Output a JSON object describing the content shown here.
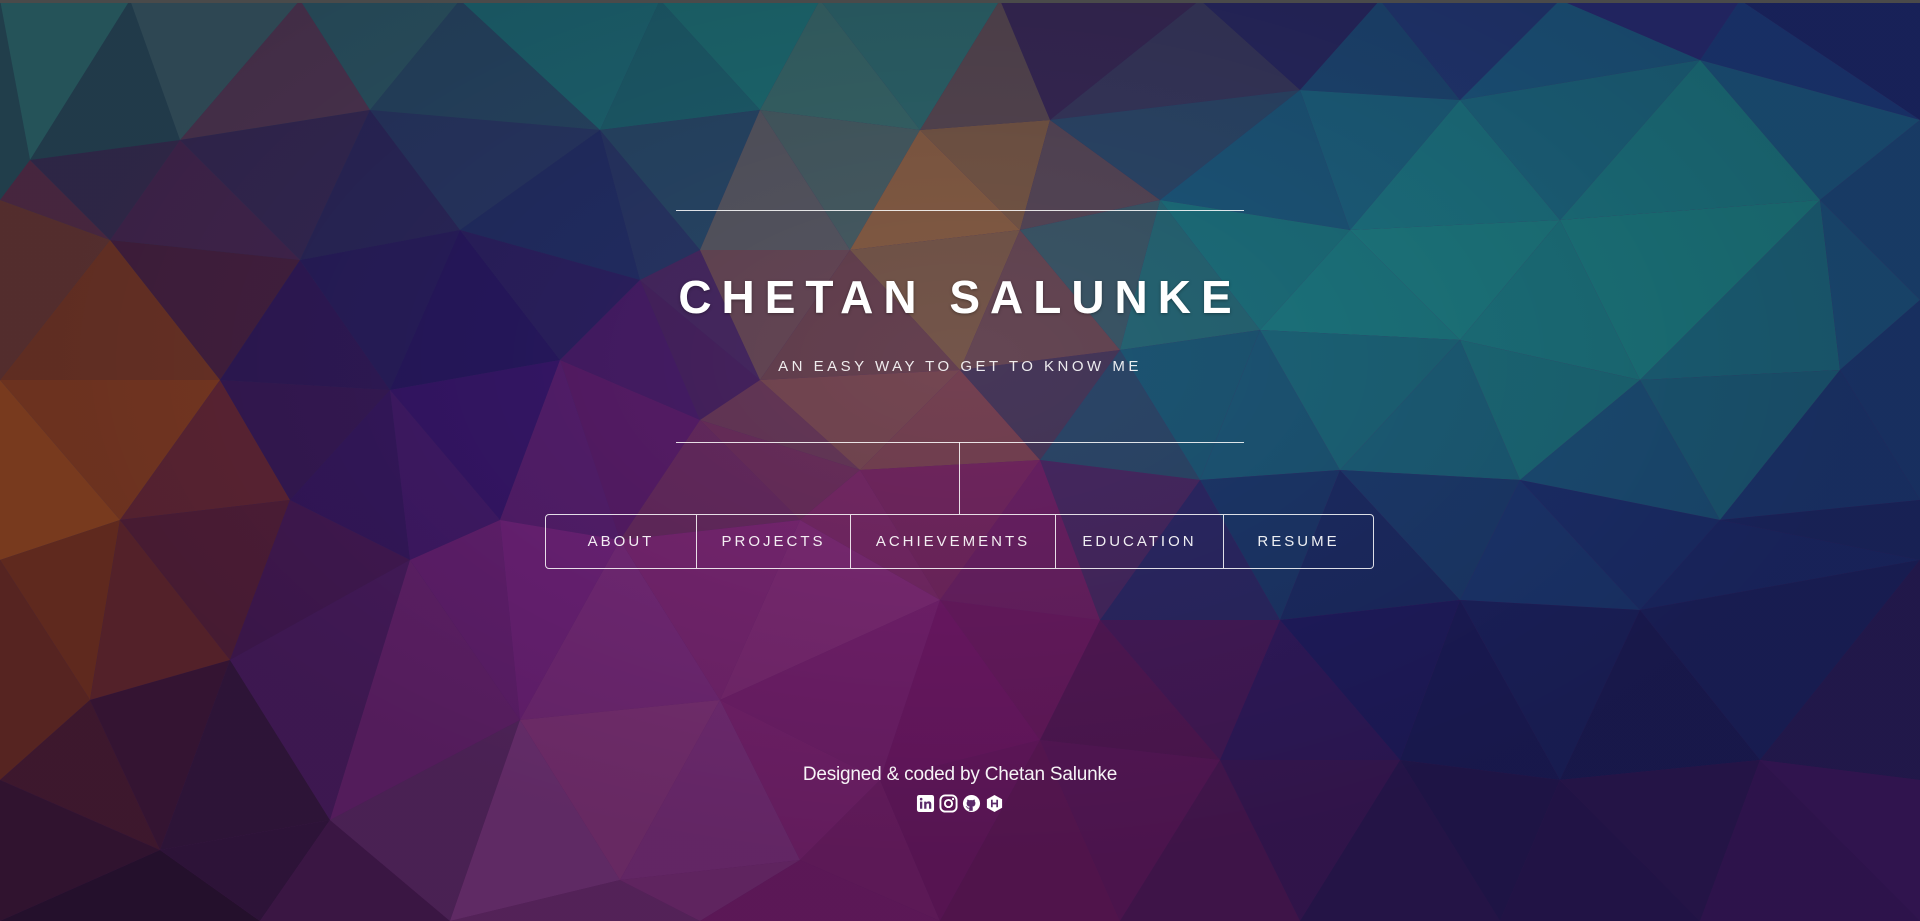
{
  "hero": {
    "title": "CHETAN SALUNKE",
    "subtitle": "AN EASY WAY TO GET TO KNOW ME"
  },
  "nav": {
    "items": [
      {
        "label": "ABOUT"
      },
      {
        "label": "PROJECTS"
      },
      {
        "label": "ACHIEVEMENTS"
      },
      {
        "label": "EDUCATION"
      },
      {
        "label": "RESUME"
      }
    ]
  },
  "footer": {
    "credit": "Designed & coded by Chetan Salunke",
    "socials": [
      "linkedin-icon",
      "instagram-icon",
      "github-icon",
      "hackerrank-icon"
    ]
  },
  "colors": {
    "text": "#ffffff",
    "lines": "#ffffff",
    "bg_teal": "#1f7a86",
    "bg_purple": "#7a2476",
    "bg_indigo": "#2c1a6e",
    "bg_orange": "#8a3a22"
  }
}
